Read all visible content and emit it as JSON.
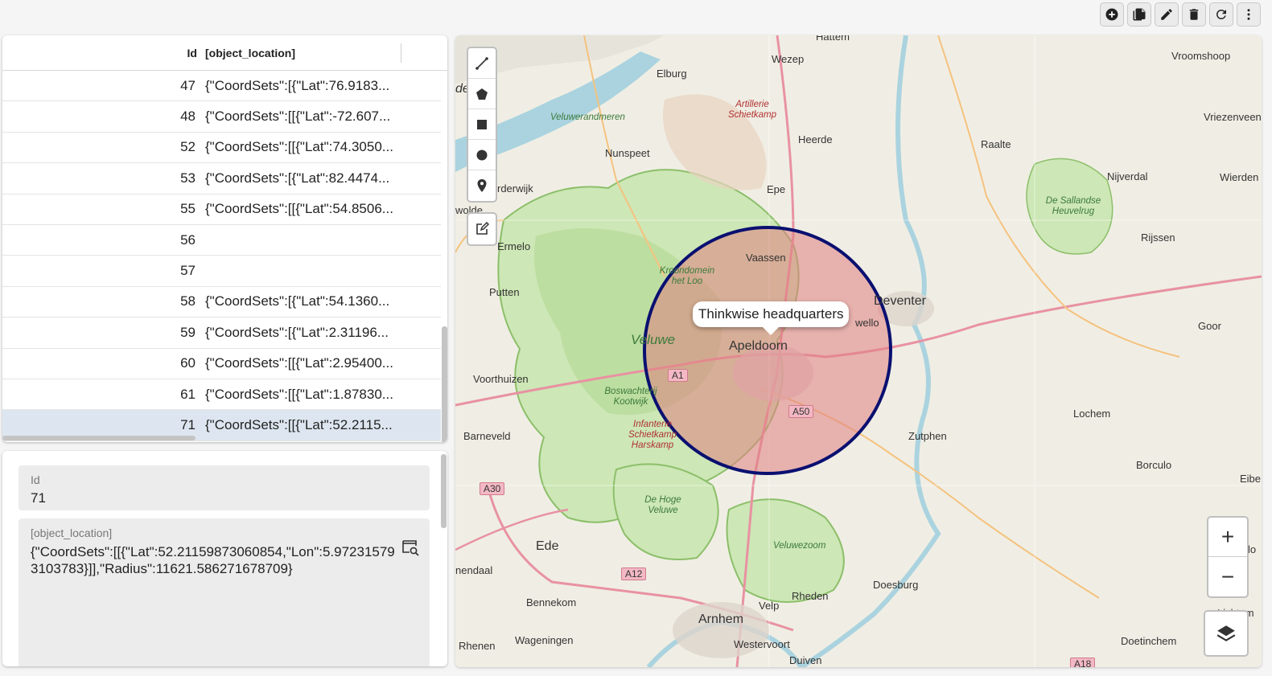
{
  "toolbar": {
    "buttons": [
      {
        "name": "add-button",
        "icon": "plus-circle-icon"
      },
      {
        "name": "copy-button",
        "icon": "copy-icon"
      },
      {
        "name": "edit-button",
        "icon": "pencil-icon"
      },
      {
        "name": "delete-button",
        "icon": "trash-icon"
      },
      {
        "name": "refresh-button",
        "icon": "refresh-icon"
      },
      {
        "name": "more-button",
        "icon": "kebab-icon"
      }
    ]
  },
  "grid": {
    "columns": {
      "id": "Id",
      "location": "[object_location]"
    },
    "rows": [
      {
        "id": "47",
        "location": "{\"CoordSets\":[{\"Lat\":76.9183..."
      },
      {
        "id": "48",
        "location": "{\"CoordSets\":[[{\"Lat\":-72.607..."
      },
      {
        "id": "52",
        "location": "{\"CoordSets\":[[{\"Lat\":74.3050..."
      },
      {
        "id": "53",
        "location": "{\"CoordSets\":[{\"Lat\":82.4474..."
      },
      {
        "id": "55",
        "location": "{\"CoordSets\":[[{\"Lat\":54.8506..."
      },
      {
        "id": "56",
        "location": ""
      },
      {
        "id": "57",
        "location": ""
      },
      {
        "id": "58",
        "location": "{\"CoordSets\":[{\"Lat\":54.1360..."
      },
      {
        "id": "59",
        "location": "{\"CoordSets\":[{\"Lat\":2.31196..."
      },
      {
        "id": "60",
        "location": "{\"CoordSets\":[[{\"Lat\":2.95400..."
      },
      {
        "id": "61",
        "location": "{\"CoordSets\":[[{\"Lat\":1.87830..."
      },
      {
        "id": "71",
        "location": "{\"CoordSets\":[[{\"Lat\":52.2115...",
        "selected": true
      }
    ]
  },
  "form": {
    "id_label": "Id",
    "id_value": "71",
    "location_label": "[object_location]",
    "location_value": "{\"CoordSets\":[[{\"Lat\":52.21159873060854,\"Lon\":5.972315793103783}]],\"Radius\":11621.586271678709}"
  },
  "map": {
    "popup": "Thinkwise headquarters",
    "circle_color": "#0a1070",
    "circle_fill": "#e08080",
    "zoom_in": "+",
    "zoom_out": "−",
    "draw_tools": [
      "polyline-icon",
      "polygon-icon",
      "rectangle-icon",
      "circle-icon",
      "marker-icon"
    ],
    "places": {
      "hattem": "Hattem",
      "wezep": "Wezep",
      "elburg": "Elburg",
      "vroomshoop": "Vroomshoop",
      "artillerie": "Artillerie Schietkamp",
      "veluwerandmeren": "Veluwerandmeren",
      "vriezenveen": "Vriezenveen",
      "nunspeet": "Nunspeet",
      "heerde": "Heerde",
      "raalte": "Raalte",
      "nijverdal": "Nijverdal",
      "wierden": "Wierden",
      "harderwijk": "rderwijk",
      "epe": "Epe",
      "sallandse": "De Sallandse Heuvelrug",
      "zwolde": "wolde",
      "ermelo": "Ermelo",
      "rijssen": "Rijssen",
      "vaassen": "Vaassen",
      "kroondomein": "Kroondomein het Loo",
      "putten": "Putten",
      "deventer": "Deventer",
      "twello": "wello",
      "veluwe": "Veluwe",
      "apeldoorn": "Apeldoorn",
      "goor": "Goor",
      "voorthuizen": "Voorthuizen",
      "boswachterij": "Boswachterij Kootwijk",
      "infanterie": "Infanterie Schietkamp Harskamp",
      "barneveld": "Barneveld",
      "zutphen": "Zutphen",
      "lochem": "Lochem",
      "borculo": "Borculo",
      "eibe": "Eibe",
      "hoge_veluwe": "De Hoge Veluwe",
      "ede": "Ede",
      "veluwezoom": "Veluwezoom",
      "lo": "lo",
      "endaal": "nendaal",
      "bennekom": "Bennekom",
      "velp": "Velp",
      "rheden": "Rheden",
      "doesburg": "Doesburg",
      "lichtem": "Lichtem",
      "arnhem": "Arnhem",
      "rhenen": "Rhenen",
      "wageningen": "Wageningen",
      "westervoort": "Westervoort",
      "duiven": "Duiven",
      "doetinchem": "Doetinchem",
      "de": "de"
    },
    "roads": {
      "a1": "A1",
      "a50": "A50",
      "a30": "A30",
      "a12": "A12",
      "a18": "A18"
    }
  }
}
